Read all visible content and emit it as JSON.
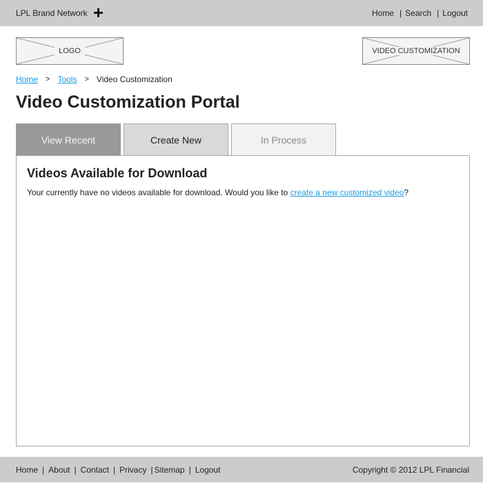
{
  "topbar": {
    "brand": "LPL Brand Network",
    "brand_icon": "plus-icon",
    "nav": [
      "Home",
      "Search",
      "Logout"
    ],
    "separator": "|"
  },
  "header": {
    "logo_placeholder": "LOGO",
    "section_placeholder": "VIDEO CUSTOMIZATION"
  },
  "breadcrumb": {
    "items": [
      "Home",
      "Tools",
      "Video Customization"
    ],
    "separator": ">"
  },
  "page_title": "Video Customization Portal",
  "tabs": [
    {
      "label": "View Recent",
      "state": "active"
    },
    {
      "label": "Create New",
      "state": "default"
    },
    {
      "label": "In Process",
      "state": "disabled"
    }
  ],
  "panel": {
    "title": "Videos Available for Download",
    "text_before": "Your currently have no videos available for download. Would you like to ",
    "link_text": "create a new customized video",
    "text_after": "?"
  },
  "footer": {
    "nav": [
      "Home",
      "About",
      "Contact",
      "Privacy",
      "Sitemap",
      "Logout"
    ],
    "separator": "|",
    "copyright": "Copyright © 2012 LPL Financial"
  },
  "colors": {
    "bar_bg": "#cccccc",
    "link": "#1e9ae0",
    "tab_active": "#999999",
    "tab_default": "#d9d9d9",
    "tab_disabled": "#f2f2f2"
  }
}
